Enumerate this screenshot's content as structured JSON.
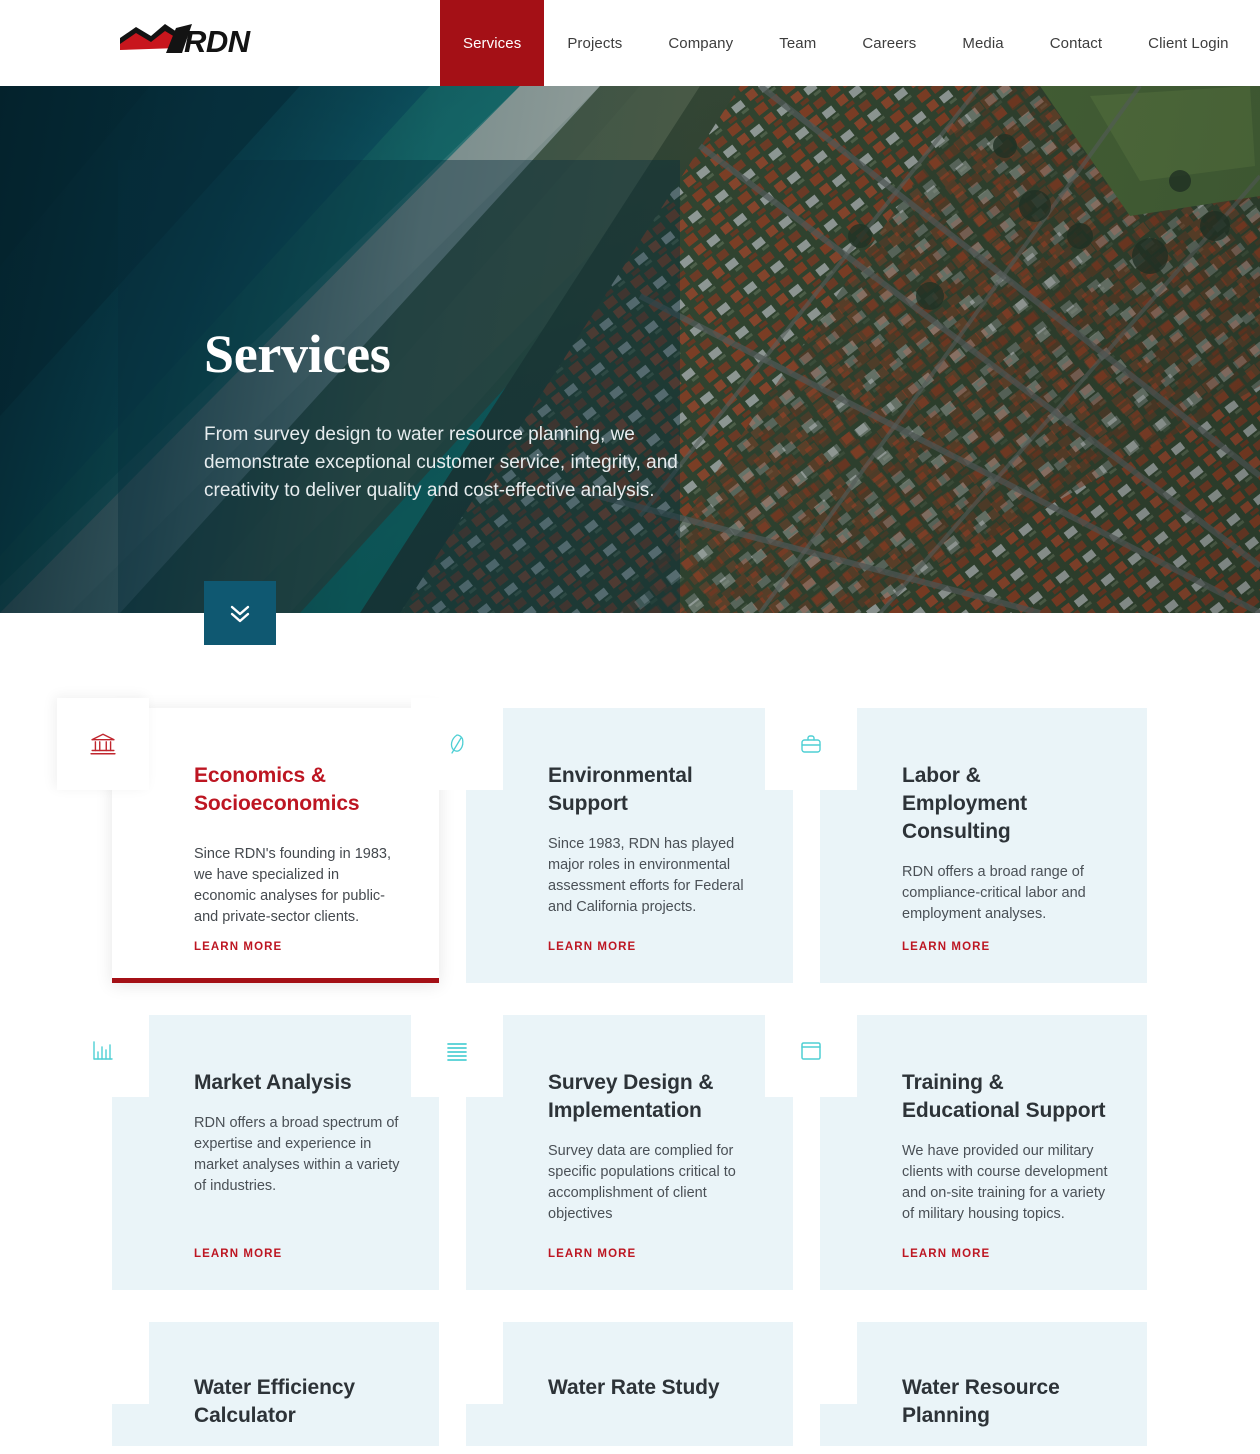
{
  "brand": {
    "name": "RDN",
    "logo_icon": "rdn-mountain-logo",
    "accent_red": "#a41016",
    "link_red": "#bd1622",
    "teal": "#4ecfd4",
    "panel_blue": "#0f5871",
    "card_bg": "#eaf4f8"
  },
  "header": {
    "nav": [
      {
        "label": "Services",
        "active": true
      },
      {
        "label": "Projects",
        "active": false
      },
      {
        "label": "Company",
        "active": false
      },
      {
        "label": "Team",
        "active": false
      },
      {
        "label": "Careers",
        "active": false
      },
      {
        "label": "Media",
        "active": false
      },
      {
        "label": "Contact",
        "active": false
      },
      {
        "label": "Client Login",
        "active": false
      }
    ]
  },
  "hero": {
    "title": "Services",
    "subtitle": "From survey design to water resource planning, we demonstrate exceptional customer service, integrity, and creativity to deliver quality and cost-effective analysis.",
    "background_image": "aerial-coastline-suburb-photo",
    "scroll_button_icon": "double-chevron-down-icon"
  },
  "services": {
    "learn_more_label": "LEARN MORE",
    "cards": [
      {
        "title": "Economics & Socioeconomics",
        "description": "Since RDN's founding in 1983, we have specialized in economic analyses for public- and private-sector clients.",
        "icon": "bank-building-icon",
        "featured": true,
        "has_link": true
      },
      {
        "title": "Environmental Support",
        "description": "Since 1983, RDN has played major roles in environmental assessment efforts for Federal and California projects.",
        "icon": "leaf-icon",
        "featured": false,
        "has_link": true
      },
      {
        "title": "Labor & Employment Consulting",
        "description": "RDN offers a broad range of compliance-critical labor and employment analyses.",
        "icon": "briefcase-icon",
        "featured": false,
        "has_link": true
      },
      {
        "title": "Market Analysis",
        "description": "RDN offers a broad spectrum of expertise and experience in market analyses within a variety of industries.",
        "icon": "bar-chart-icon",
        "featured": false,
        "has_link": true
      },
      {
        "title": "Survey Design & Implementation",
        "description": "Survey data are complied for specific populations critical to accomplishment of client objectives",
        "icon": "list-lines-icon",
        "featured": false,
        "has_link": true
      },
      {
        "title": "Training & Educational Support",
        "description": "We have provided our military clients with course development and on-site training for a variety of military housing topics.",
        "icon": "presentation-board-icon",
        "featured": false,
        "has_link": true
      },
      {
        "title": "Water Efficiency Calculator",
        "description": "",
        "icon": "calculator-icon",
        "featured": false,
        "has_link": false
      },
      {
        "title": "Water Rate Study",
        "description": "",
        "icon": "water-waves-icon",
        "featured": false,
        "has_link": false
      },
      {
        "title": "Water Resource Planning",
        "description": "",
        "icon": "clipboard-icon",
        "featured": false,
        "has_link": false
      }
    ]
  }
}
